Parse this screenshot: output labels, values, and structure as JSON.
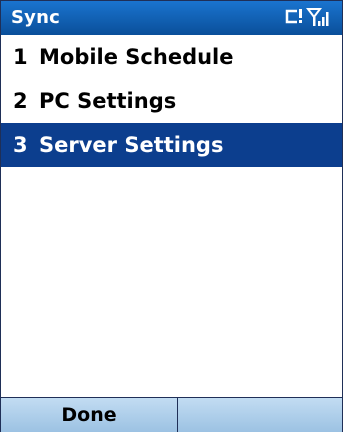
{
  "title_bar": {
    "title": "Sync",
    "icons": [
      "sync-status-icon",
      "signal-strength-icon"
    ]
  },
  "menu": {
    "items": [
      {
        "number": "1",
        "label": "Mobile Schedule",
        "selected": false
      },
      {
        "number": "2",
        "label": "PC Settings",
        "selected": false
      },
      {
        "number": "3",
        "label": "Server Settings",
        "selected": true
      }
    ]
  },
  "softkeys": {
    "left_label": "Done",
    "right_label": ""
  },
  "colors": {
    "title_bar": "#0f5fb0",
    "selection": "#0c3e8e",
    "softkey_bar": "#a9cbe8"
  }
}
